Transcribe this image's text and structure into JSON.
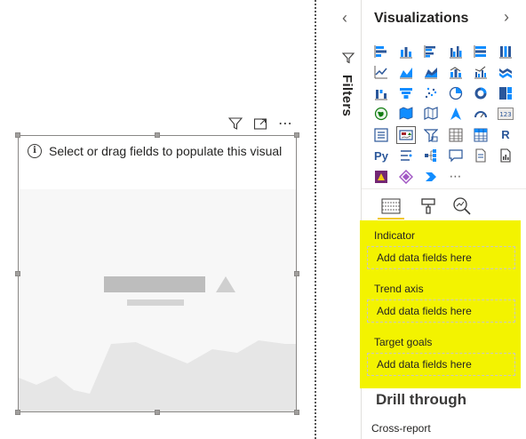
{
  "visual": {
    "message": "Select or drag fields to populate this visual",
    "header_icons": [
      "filter-icon",
      "focus-mode-icon",
      "more-options-icon"
    ],
    "more_label": "⋯"
  },
  "filters": {
    "label": "Filters",
    "collapse_glyph": "‹"
  },
  "viz": {
    "title": "Visualizations",
    "expand_glyph": "›",
    "icons": [
      "stacked-bar-chart-icon",
      "stacked-column-chart-icon",
      "clustered-bar-chart-icon",
      "clustered-column-chart-icon",
      "100-stacked-bar-chart-icon",
      "100-stacked-column-chart-icon",
      "line-chart-icon",
      "area-chart-icon",
      "stacked-area-chart-icon",
      "line-and-stacked-column-icon",
      "line-and-clustered-column-icon",
      "ribbon-chart-icon",
      "waterfall-chart-icon",
      "funnel-chart-icon",
      "scatter-chart-icon",
      "pie-chart-icon",
      "donut-chart-icon",
      "treemap-icon",
      "map-icon",
      "filled-map-icon",
      "shape-map-icon",
      "azure-map-icon",
      "gauge-icon",
      "card-icon",
      "multi-row-card-icon",
      "kpi-icon",
      "slicer-icon",
      "table-icon",
      "matrix-icon",
      "r-visual-icon",
      "python-visual-icon",
      "key-influencers-icon",
      "decomposition-tree-icon",
      "qa-icon",
      "smart-narrative-icon",
      "paginated-report-icon",
      "power-apps-icon",
      "power-automate-icon",
      "arcgis-icon",
      "more-visuals-icon"
    ],
    "r_label": "R",
    "py_label": "Py",
    "more_label": "⋯",
    "tabs": [
      "fields-tab-icon",
      "format-tab-icon",
      "analytics-tab-icon"
    ]
  },
  "wells": {
    "highlight_color": "#f3f300",
    "items": [
      {
        "label": "Indicator",
        "placeholder": "Add data fields here"
      },
      {
        "label": "Trend axis",
        "placeholder": "Add data fields here"
      },
      {
        "label": "Target goals",
        "placeholder": "Add data fields here"
      }
    ]
  },
  "drill": {
    "title": "Drill through",
    "cross_report": "Cross-report"
  },
  "colors": {
    "accent_blue": "#2b579a",
    "accent_cyan": "#118dff",
    "brand_yellow": "#f2c811"
  }
}
